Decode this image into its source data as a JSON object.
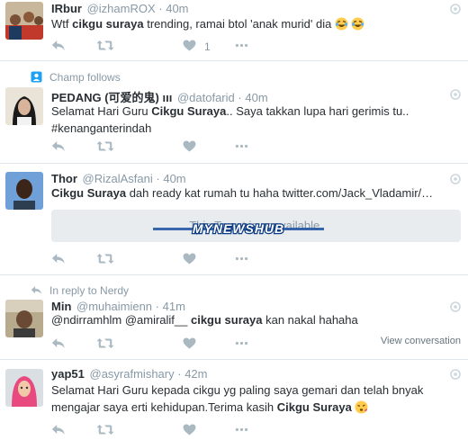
{
  "tweets": [
    {
      "name": "IRbur",
      "handle": "@izhamROX",
      "time": "40m",
      "text_parts": [
        "Wtf ",
        "cikgu suraya",
        " trending, ramai btol 'anak murid' dia"
      ],
      "like_count": "1"
    },
    {
      "context": "Champ follows",
      "name": "PEDANG (可爱的鬼) ııı",
      "handle": "@datofarid",
      "time": "40m",
      "line1_parts": [
        "Selamat Hari Guru ",
        "Cikgu Suraya",
        ".. Saya takkan lupa hari gerimis tu.."
      ],
      "line2": "#kenanganterindah"
    },
    {
      "name": "Thor",
      "handle": "@RizalAsfani",
      "time": "40m",
      "text_bold": "Cikgu Suraya",
      "text_rest": " dah ready kat rumah tu haha ",
      "link": "twitter.com/Jack_Vladamir/…",
      "card_text": "This Tweet is unavailable.",
      "watermark": "MYNEWSHUB"
    },
    {
      "context": "In reply to Nerdy",
      "name": "Min",
      "handle": "@muhaimienn",
      "time": "41m",
      "text_parts": [
        "@ndirramhlm @amiralif__ ",
        "cikgu suraya",
        " kan nakal hahaha"
      ],
      "view_conversation": "View conversation"
    },
    {
      "name": "yap51",
      "handle": "@asyrafmishary",
      "time": "42m",
      "line1": "Selamat Hari Guru kepada cikgu yg paling saya gemari dan telah bnyak",
      "line2_parts": [
        "mengajar saya erti kehidupan.Terima kasih ",
        "Cikgu Suraya"
      ]
    }
  ],
  "separator": "·",
  "icons": [
    "reply-icon",
    "retweet-icon",
    "like-icon",
    "more-icon",
    "gear-icon",
    "follow-icon",
    "reply-context-icon",
    "laughing-emoji",
    "kiss-emoji"
  ],
  "colors": {
    "muted": "#8899a6",
    "text": "#292f33",
    "icon": "#aab8c2",
    "border": "#e1e8ed",
    "card": "#e8ecef",
    "follow_badge": "#1da1f2"
  }
}
